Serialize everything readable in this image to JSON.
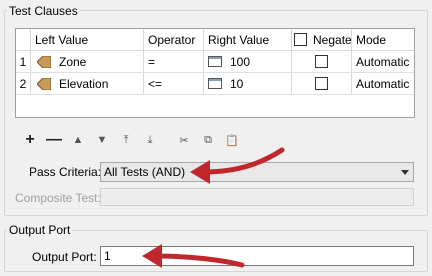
{
  "test_clauses": {
    "title": "Test Clauses",
    "headers": {
      "row_num": "",
      "left_value": "Left Value",
      "operator": "Operator",
      "right_value": "Right Value",
      "negate": "Negate",
      "mode": "Mode"
    },
    "rows": [
      {
        "num": "1",
        "left_value": "Zone",
        "operator": "=",
        "right_value": "100",
        "negate": false,
        "mode": "Automatic"
      },
      {
        "num": "2",
        "left_value": "Elevation",
        "operator": "<=",
        "right_value": "10",
        "negate": false,
        "mode": "Automatic"
      }
    ],
    "toolbar": {
      "add": "+",
      "remove": "—",
      "move_up": "▲",
      "move_down": "▼",
      "move_top": "⤒",
      "move_bottom": "⤓",
      "cut": "✂",
      "copy": "⧉",
      "paste": "📋"
    },
    "pass_criteria_label": "Pass Criteria:",
    "pass_criteria_value": "All Tests (AND)",
    "composite_test_label": "Composite Test:",
    "composite_test_value": ""
  },
  "output_port": {
    "title": "Output Port",
    "label": "Output Port:",
    "value": "1"
  },
  "colors": {
    "annotation_arrow": "#c0282d",
    "attribute_icon": "#c89a5a"
  }
}
